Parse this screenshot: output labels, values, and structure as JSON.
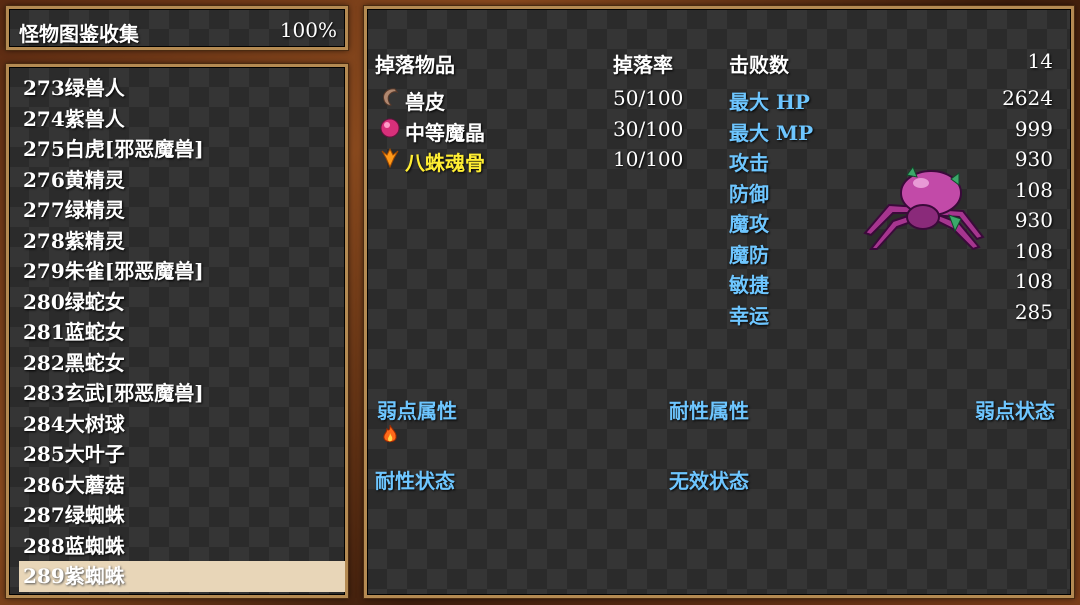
{
  "header": {
    "title": "怪物图鉴收集",
    "percent": "100%"
  },
  "monster_list": [
    "273绿兽人",
    "274紫兽人",
    "275白虎[邪恶魔兽]",
    "276黄精灵",
    "277绿精灵",
    "278紫精灵",
    "279朱雀[邪恶魔兽]",
    "280绿蛇女",
    "281蓝蛇女",
    "282黑蛇女",
    "283玄武[邪恶魔兽]",
    "284大树球",
    "285大叶子",
    "286大蘑菇",
    "287绿蜘蛛",
    "288蓝蜘蛛",
    "289紫蜘蛛"
  ],
  "selected_index": 16,
  "drops": {
    "header_item": "掉落物品",
    "header_rate": "掉落率",
    "items": [
      {
        "name": "兽皮",
        "rate": "50/100",
        "icon": "hide-icon",
        "color": "#ffffff"
      },
      {
        "name": "中等魔晶",
        "rate": "30/100",
        "icon": "crystal-icon",
        "color": "#ffffff"
      },
      {
        "name": "八蛛魂骨",
        "rate": "10/100",
        "icon": "soul-bone-icon",
        "color": "#ffee33"
      }
    ]
  },
  "stats": {
    "kills_label": "击败数",
    "kills_value": "14",
    "rows": [
      {
        "label": "最大 HP",
        "value": "2624"
      },
      {
        "label": "最大 MP",
        "value": "999"
      },
      {
        "label": "攻击",
        "value": "930"
      },
      {
        "label": "防御",
        "value": "108"
      },
      {
        "label": "魔攻",
        "value": "930"
      },
      {
        "label": "魔防",
        "value": "108"
      },
      {
        "label": "敏捷",
        "value": "108"
      },
      {
        "label": "幸运",
        "value": "285"
      }
    ]
  },
  "attributes": {
    "weak_attr": "弱点属性",
    "resist_attr": "耐性属性",
    "weak_state": "弱点状态",
    "resist_state": "耐性状态",
    "invalid_state": "无效状态",
    "weak_attr_icons": [
      "fire-icon"
    ]
  },
  "colors": {
    "label_blue": "#6ec6ff",
    "rare_yellow": "#ffee33",
    "selection": "#e8d6b8",
    "frame": "#b48a52"
  }
}
